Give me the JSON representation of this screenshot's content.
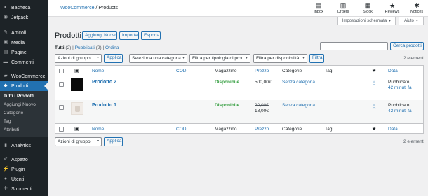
{
  "sidebar": {
    "items": [
      {
        "label": "Bacheca",
        "icon": "dashboard-icon",
        "glyph": "◐"
      },
      {
        "label": "Jetpack",
        "icon": "jetpack-icon",
        "glyph": "◉"
      },
      {
        "label": "Articoli",
        "icon": "pin-icon",
        "glyph": "✎"
      },
      {
        "label": "Media",
        "icon": "media-icon",
        "glyph": "▣"
      },
      {
        "label": "Pagine",
        "icon": "pages-icon",
        "glyph": "▤"
      },
      {
        "label": "Commenti",
        "icon": "comments-icon",
        "glyph": "▬"
      },
      {
        "label": "WooCommerce",
        "icon": "woocommerce-icon",
        "glyph": "▰"
      },
      {
        "label": "Prodotti",
        "icon": "products-icon",
        "glyph": "◆"
      }
    ],
    "submenu": [
      "Tutti i Prodotti",
      "Aggiungi Nuovo",
      "Categorie",
      "Tag",
      "Attributi"
    ],
    "bottom": [
      {
        "label": "Analytics",
        "icon": "analytics-icon",
        "glyph": "▮"
      },
      {
        "label": "Aspetto",
        "icon": "appearance-icon",
        "glyph": "✐"
      },
      {
        "label": "Plugin",
        "icon": "plugin-icon",
        "glyph": "⚡"
      },
      {
        "label": "Utenti",
        "icon": "users-icon",
        "glyph": "●"
      },
      {
        "label": "Strumenti",
        "icon": "tools-icon",
        "glyph": "✚"
      }
    ]
  },
  "header": {
    "breadcrumb_link": "WooCommerce",
    "breadcrumb_sep": " / ",
    "breadcrumb_current": "Products",
    "actions": [
      {
        "label": "Inbox",
        "icon": "inbox-icon",
        "glyph": "▤"
      },
      {
        "label": "Orders",
        "icon": "orders-icon",
        "glyph": "▥"
      },
      {
        "label": "Stock",
        "icon": "stock-icon",
        "glyph": "▦"
      },
      {
        "label": "Reviews",
        "icon": "reviews-icon",
        "glyph": "★"
      },
      {
        "label": "Notices",
        "icon": "notices-icon",
        "glyph": "✱"
      }
    ]
  },
  "screen_options": "Impostazioni schermata",
  "help": "Aiuto",
  "page": {
    "title": "Prodotti",
    "add_new": "Aggiungi Nuovo",
    "import": "Importa",
    "export": "Esporta"
  },
  "views": {
    "all": "Tutti",
    "all_count": "(2)",
    "published": "Pubblicati",
    "published_count": "(2)",
    "sort": "Ordina",
    "sep": "|"
  },
  "search": {
    "button": "Cerca prodotti",
    "value": ""
  },
  "filters": {
    "bulk_action": "Azioni di gruppo",
    "apply": "Applica",
    "category": "Seleziona una categoria",
    "product_type": "Filtra per tipologia di prod",
    "stock": "Filtra per disponibilità",
    "filter": "Filtra"
  },
  "count_label": "2 elementi",
  "table": {
    "columns": {
      "name": "Nome",
      "sku": "COD",
      "stock": "Magazzino",
      "price": "Prezzo",
      "categories": "Categorie",
      "tags": "Tag",
      "date": "Data"
    },
    "rows": [
      {
        "name": "Prodotto 2",
        "sku": "–",
        "stock": "Disponibile",
        "price": "500,00€",
        "price_old": "",
        "category": "Senza categoria",
        "tag": "–",
        "date_status": "Pubblicato",
        "date_ago": "42 minuti fa"
      },
      {
        "name": "Prodotto 1",
        "sku": "–",
        "stock": "Disponibile",
        "price_old": "20,00€",
        "price": "18,00€",
        "category": "Senza categoria",
        "tag": "–",
        "date_status": "Pubblicato",
        "date_ago": "42 minuti fa"
      }
    ]
  },
  "colors": {
    "sidebar": "#1d2327",
    "accent": "#2271b1",
    "instock": "#2e9b3a"
  }
}
